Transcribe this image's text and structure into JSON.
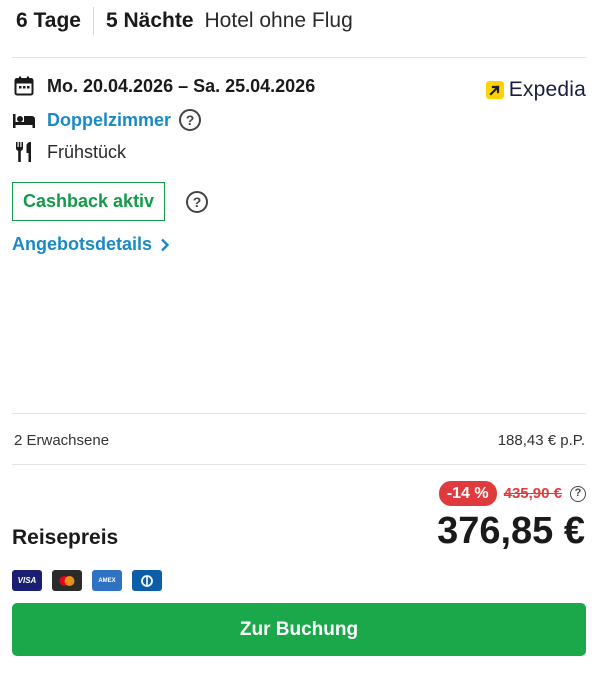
{
  "header": {
    "days": "6 Tage",
    "nights": "5 Nächte",
    "type": "Hotel ohne Flug"
  },
  "offer": {
    "date_range": "Mo. 20.04.2026 – Sa. 25.04.2026",
    "room": "Doppelzimmer",
    "board": "Frühstück",
    "provider": "Expedia",
    "cashback_label": "Cashback aktiv",
    "details_link": "Angebotsdetails",
    "icons": {
      "date": "calendar-icon",
      "room": "bed-icon",
      "board": "cutlery-icon",
      "details": "chevron-right-icon",
      "help": "question-circle-icon"
    }
  },
  "pricing": {
    "travelers": "2 Erwachsene",
    "per_person": "188,43 € p.P.",
    "discount": "-14 %",
    "old_price": "435,90 €",
    "label": "Reisepreis",
    "total": "376,85 €",
    "payment_methods": [
      "VISA",
      "Mastercard",
      "AMEX",
      "Diners"
    ]
  },
  "cta": {
    "label": "Zur Buchung"
  },
  "colors": {
    "link_blue": "#1a8ac4",
    "green": "#1ba84b",
    "discount_red": "#e03a3e",
    "expedia_yellow": "#ffd200"
  }
}
